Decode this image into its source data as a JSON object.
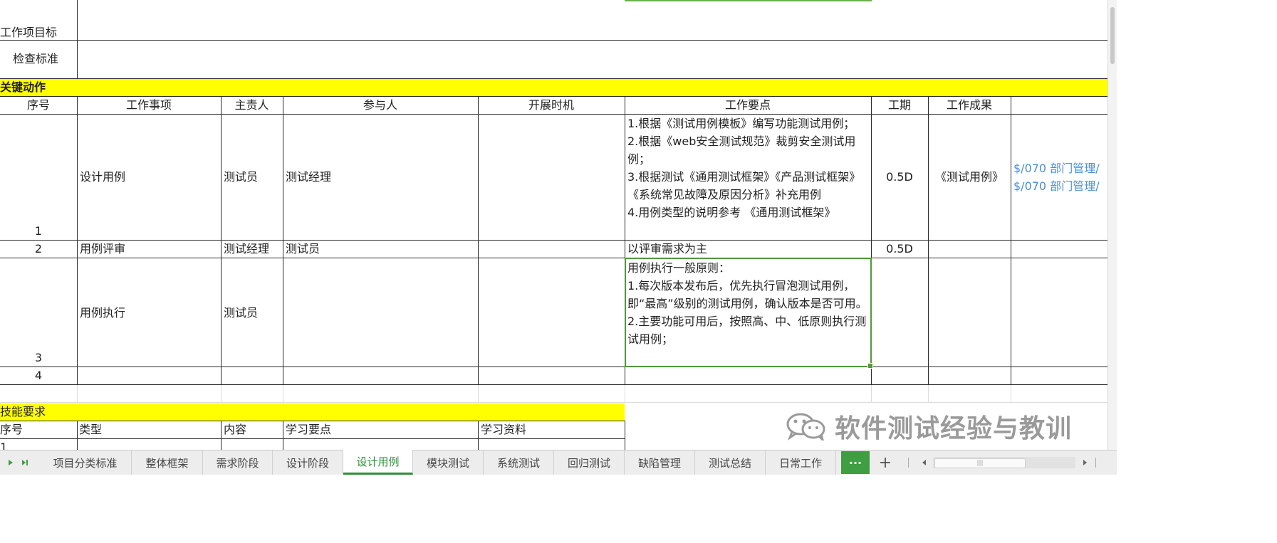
{
  "header_rows": {
    "objective_label": "工作项目标",
    "criteria_label": "检查标准"
  },
  "key_actions": {
    "title": "关键动作",
    "columns": [
      "序号",
      "工作事项",
      "主责人",
      "参与人",
      "开展时机",
      "工作要点",
      "工期",
      "工作成果"
    ],
    "rows": [
      {
        "num": "1",
        "item": "设计用例",
        "owner": "测试员",
        "participant": "测试经理",
        "timing": "",
        "points": [
          "1.根据《测试用例模板》编写功能测试用例；",
          "2.根据《web安全测试规范》裁剪安全测试用例；",
          "3.根据测试《通用测试框架》《产品测试框架》《系统常见故障及原因分析》补充用例",
          "4.用例类型的说明参考 《通用测试框架》"
        ],
        "duration": "0.5D",
        "result": "《测试用例》",
        "links": [
          "$/070 部门管理/",
          "$/070 部门管理/"
        ]
      },
      {
        "num": "2",
        "item": "用例评审",
        "owner": "测试经理",
        "participant": "测试员",
        "timing": "",
        "points": [
          "以评审需求为主"
        ],
        "duration": "0.5D",
        "result": ""
      },
      {
        "num": "3",
        "item": "用例执行",
        "owner": "测试员",
        "participant": "",
        "timing": "",
        "points": [
          "用例执行一般原则：",
          "1.每次版本发布后，优先执行冒泡测试用例，即“最高”级别的测试用例，确认版本是否可用。",
          "2.主要功能可用后，按照高、中、低原则执行测试用例；"
        ],
        "duration": "",
        "result": ""
      },
      {
        "num": "4",
        "item": "",
        "owner": "",
        "participant": "",
        "timing": "",
        "points": [
          ""
        ],
        "duration": "",
        "result": ""
      }
    ]
  },
  "skills": {
    "title": "技能要求",
    "columns": [
      "序号",
      "类型",
      "内容",
      "学习要点",
      "学习资料"
    ],
    "first_row_num": "1"
  },
  "watermark": {
    "text": "软件测试经验与教训",
    "icon": "wechat-icon"
  },
  "tabs": {
    "items": [
      "项目分类标准",
      "整体框架",
      "需求阶段",
      "设计阶段",
      "设计用例",
      "模块测试",
      "系统测试",
      "回归测试",
      "缺陷管理",
      "测试总结",
      "日常工作"
    ],
    "active_index": 4,
    "more_label": "···",
    "add_label": "+"
  },
  "colors": {
    "section_header": "#ffff00",
    "selection": "#4f9a39",
    "active_tab": "#2f8f3a",
    "link": "#4a8fd8"
  }
}
